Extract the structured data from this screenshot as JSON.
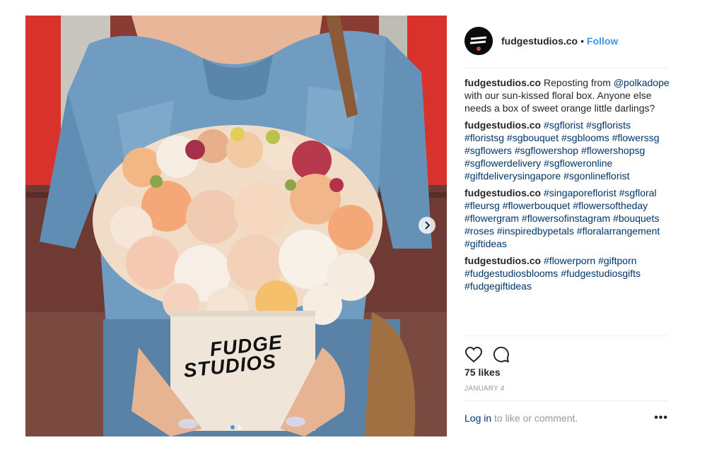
{
  "post": {
    "username": "fudgestudios.co",
    "separator": "•",
    "follow_label": "Follow",
    "avatar_icon": "brand-logo-icon",
    "media": {
      "box_brand": [
        "FUDGE",
        "STUDIOS"
      ],
      "carousel_dots": 2,
      "active_dot": 0
    },
    "caption": {
      "user": "fudgestudios.co",
      "text_before": " Reposting from ",
      "mention": "@polkadope",
      "text_after": " with our sun-kissed floral box. Anyone else needs a box of sweet orange little darlings?"
    },
    "comments": [
      {
        "user": "fudgestudios.co",
        "tags": [
          "#sgflorist",
          "#sgflorists",
          "#floristsg",
          "#sgbouquet",
          "#sgblooms",
          "#flowerssg",
          "#sgflowers",
          "#sgflowershop",
          "#flowershopsg",
          "#sgflowerdelivery",
          "#sgfloweronline",
          "#giftdeliverysingapore",
          "#sgonlineflorist"
        ]
      },
      {
        "user": "fudgestudios.co",
        "tags": [
          "#singaporeflorist",
          "#sgfloral",
          "#fleursg",
          "#flowerbouquet",
          "#flowersoftheday",
          "#flowergram",
          "#flowersofinstagram",
          "#bouquets",
          "#roses",
          "#inspiredbypetals",
          "#floralarrangement",
          "#giftideas"
        ]
      },
      {
        "user": "fudgestudios.co",
        "tags": [
          "#flowerporn",
          "#giftporn",
          "#fudgestudiosblooms",
          "#fudgestudiosgifts",
          "#fudgegiftideas"
        ]
      }
    ],
    "likes": "75 likes",
    "date": "JANUARY 4",
    "login_link": "Log in",
    "login_rest": " to like or comment.",
    "more_label": "•••",
    "icons": {
      "like": "heart-icon",
      "comment": "comment-icon",
      "next": "chevron-right-icon",
      "more": "more-options-icon"
    }
  }
}
